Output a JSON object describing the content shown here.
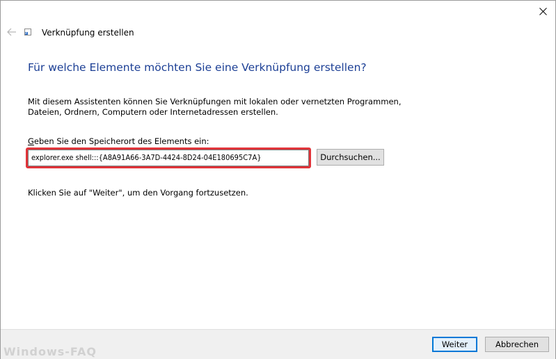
{
  "window": {
    "close_icon": "close-icon"
  },
  "wizard": {
    "back_icon": "back-arrow-icon",
    "icon": "shortcut-icon",
    "title": "Verknüpfung erstellen",
    "heading": "Für welche Elemente möchten Sie eine Verknüpfung erstellen?",
    "description": "Mit diesem Assistenten können Sie Verknüpfungen mit lokalen oder vernetzten Programmen, Dateien, Ordnern, Computern oder Internetadressen erstellen.",
    "location_label_accesskey": "G",
    "location_label_rest": "eben Sie den Speicherort des Elements ein:",
    "location_value": "explorer.exe shell:::{A8A91A66-3A7D-4424-8D24-04E180695C7A}",
    "browse_label": "Durchsuchen...",
    "continue_hint": "Klicken Sie auf \"Weiter\", um den Vorgang fortzusetzen."
  },
  "footer": {
    "next_label": "Weiter",
    "cancel_label": "Abbrechen"
  },
  "watermark": "Windows-FAQ",
  "colors": {
    "heading": "#1c3f95",
    "highlight": "#e0343a",
    "default_button_border": "#0078d7",
    "footer_background": "#f0f0f0"
  }
}
